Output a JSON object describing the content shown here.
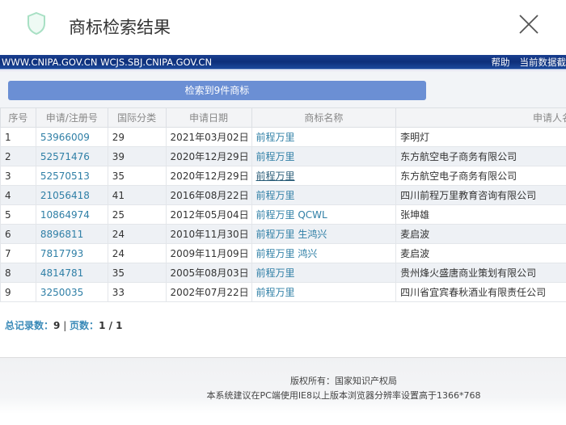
{
  "window": {
    "title": "商标检索结果"
  },
  "urlbar": {
    "sites": "WWW.CNIPA.GOV.CN WCJS.SBJ.CNIPA.GOV.CN",
    "help": "帮助",
    "current_db": "当前数据截"
  },
  "result_button": "检索到9件商标",
  "table": {
    "headers": [
      "序号",
      "申请/注册号",
      "国际分类",
      "申请日期",
      "商标名称",
      "申请人名称"
    ],
    "rows": [
      [
        "1",
        "53966009",
        "29",
        "2021年03月02日",
        "前程万里",
        "李明灯"
      ],
      [
        "2",
        "52571476",
        "39",
        "2020年12月29日",
        "前程万里",
        "东方航空电子商务有限公司"
      ],
      [
        "3",
        "52570513",
        "35",
        "2020年12月29日",
        "前程万里",
        "东方航空电子商务有限公司"
      ],
      [
        "4",
        "21056418",
        "41",
        "2016年08月22日",
        "前程万里",
        "四川前程万里教育咨询有限公司"
      ],
      [
        "5",
        "10864974",
        "25",
        "2012年05月04日",
        "前程万里 QCWL",
        "张坤雄"
      ],
      [
        "6",
        "8896811",
        "24",
        "2010年11月30日",
        "前程万里 生鸿兴",
        "麦启波"
      ],
      [
        "7",
        "7817793",
        "24",
        "2009年11月09日",
        "前程万里 鸿兴",
        "麦启波"
      ],
      [
        "8",
        "4814781",
        "35",
        "2005年08月03日",
        "前程万里",
        "贵州烽火盛唐商业策划有限公司"
      ],
      [
        "9",
        "3250035",
        "33",
        "2002年07月22日",
        "前程万里",
        "四川省宜宾春秋酒业有限责任公司"
      ]
    ]
  },
  "summary": {
    "total_label": "总记录数：",
    "total": "9",
    "sep": " | ",
    "pages_label": "页数：",
    "pages": "1 / 1"
  },
  "footer": {
    "copyright": "版权所有：国家知识产权局",
    "advice": "本系统建议在PC端使用IE8以上版本浏览器分辨率设置高于1366*768"
  }
}
